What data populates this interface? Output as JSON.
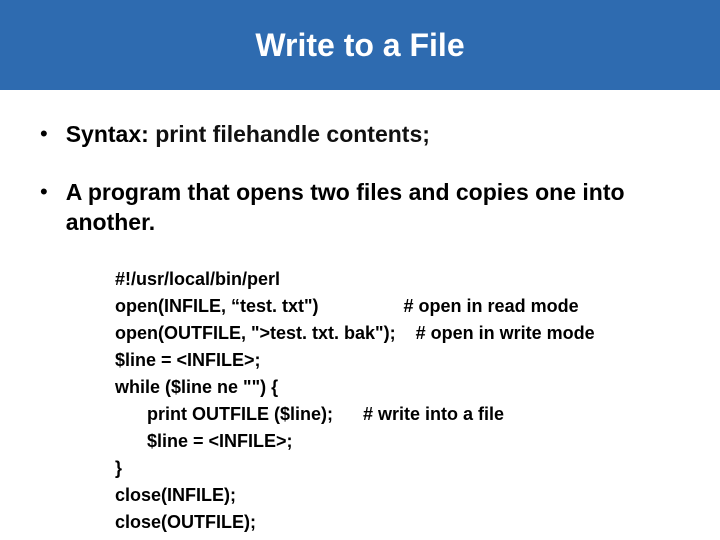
{
  "title": "Write to  a File",
  "bullets": {
    "b1_label": "Syntax: ",
    "b1_code": "print filehandle contents;",
    "b2": "A program that opens two files and copies one into another."
  },
  "code": {
    "l1": "#!/usr/local/bin/perl",
    "l2": "open(INFILE, “test. txt\")                 # open in read mode",
    "l3": "open(OUTFILE, \">test. txt. bak\");    # open in write mode",
    "l4": "$line = <INFILE>;",
    "l5": "while ($line ne \"\") {",
    "l6": "print OUTFILE ($line);      # write into a file",
    "l7": "$line = <INFILE>;",
    "l8": "}",
    "l9": "close(INFILE);",
    "l10": "close(OUTFILE);"
  }
}
